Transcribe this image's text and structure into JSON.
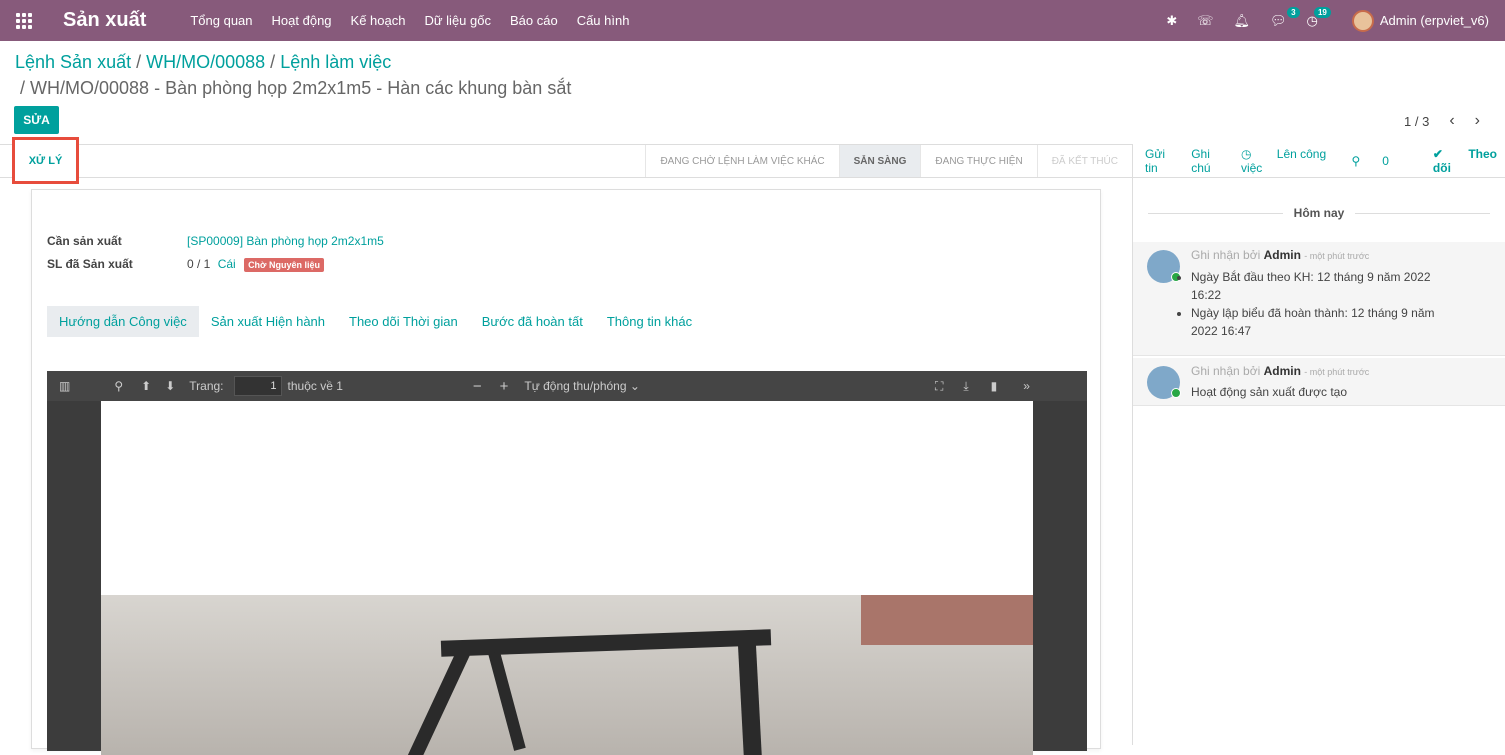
{
  "navbar": {
    "app_name": "Sản xuất",
    "menu": [
      "Tổng quan",
      "Hoạt động",
      "Kế hoạch",
      "Dữ liệu gốc",
      "Báo cáo",
      "Cấu hình"
    ],
    "chat_count": "3",
    "activity_count": "19",
    "user": "Admin (erpviet_v6)"
  },
  "breadcrumb": {
    "items": [
      "Lệnh Sản xuất",
      "WH/MO/00088",
      "Lệnh làm việc"
    ],
    "separator": "/",
    "current": "WH/MO/00088 - Bàn phòng họp 2m2x1m5 - Hàn các khung bàn sắt"
  },
  "toolbar": {
    "edit_label": "SỬA",
    "pager": "1 / 3"
  },
  "statusbar": {
    "process_label": "XỬ LÝ",
    "stages": [
      "ĐANG CHỜ LỆNH LÀM VIỆC KHÁC",
      "SẴN SÀNG",
      "ĐANG THỰC HIỆN",
      "ĐÃ KẾT THÚC"
    ],
    "active_index": 1
  },
  "form": {
    "product_label": "Cần sản xuất",
    "product_value": "[SP00009] Bàn phòng họp 2m2x1m5",
    "qty_label": "SL đã Sản xuất",
    "qty_value": "0 / 1",
    "qty_uom": "Cái",
    "qty_tag": "Chờ Nguyên liệu",
    "tabs": [
      "Hướng dẫn Công việc",
      "Sản xuất Hiện hành",
      "Theo dõi Thời gian",
      "Bước đã hoàn tất",
      "Thông tin khác"
    ]
  },
  "pdf": {
    "page_label": "Trang:",
    "page_value": "1",
    "page_of": "thuộc về 1",
    "zoom": "Tự động thu/phóng"
  },
  "chatter": {
    "actions": [
      "Gửi tin",
      "Ghi chú",
      "Lên công việc",
      "0",
      "Theo dõi"
    ],
    "day": "Hôm nay",
    "messages": [
      {
        "prefix": "Ghi nhận bởi",
        "author": "Admin",
        "time": "- một phút trước",
        "items": [
          "Ngày Bắt đầu theo KH: 12 tháng 9 năm 2022 16:22",
          "Ngày lập biểu đã hoàn thành: 12 tháng 9 năm 2022 16:47"
        ]
      },
      {
        "prefix": "Ghi nhận bởi",
        "author": "Admin",
        "time": "- một phút trước",
        "text": "Hoạt động sản xuất được tạo"
      }
    ]
  }
}
